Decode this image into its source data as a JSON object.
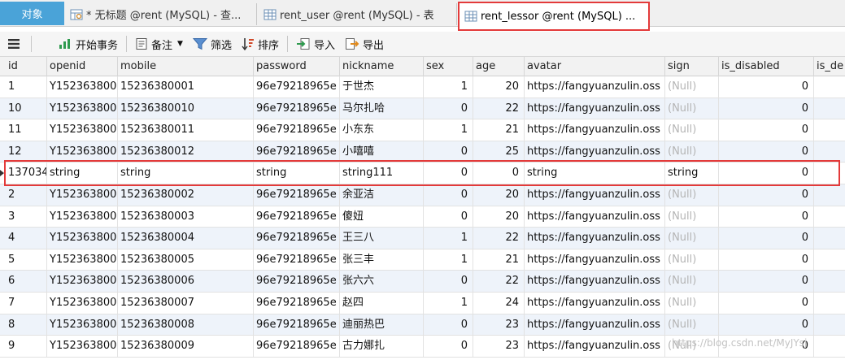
{
  "tabs": {
    "objects_label": "对象",
    "query_tab_label": "* 无标题 @rent (MySQL) - 查...",
    "user_tab_label": "rent_user @rent (MySQL) - 表",
    "active_tab_label": "rent_lessor @rent (MySQL) ..."
  },
  "toolbar": {
    "menu_icon": "hamburger-icon",
    "begin_tx_label": "开始事务",
    "note_label": "备注",
    "filter_label": "筛选",
    "sort_label": "排序",
    "import_label": "导入",
    "export_label": "导出"
  },
  "grid": {
    "columns": [
      "id",
      "openid",
      "mobile",
      "password",
      "nickname",
      "sex",
      "age",
      "avatar",
      "sign",
      "is_disabled",
      "is_de"
    ],
    "rows": [
      [
        "1",
        "Y152363800",
        "15236380001",
        "96e79218965e",
        "于世杰",
        "1",
        "20",
        "https://fangyuanzulin.oss",
        "(Null)",
        "0"
      ],
      [
        "10",
        "Y152363800",
        "15236380010",
        "96e79218965e",
        "马尔扎哈",
        "0",
        "22",
        "https://fangyuanzulin.oss",
        "(Null)",
        "0"
      ],
      [
        "11",
        "Y152363800",
        "15236380011",
        "96e79218965e",
        "小东东",
        "1",
        "21",
        "https://fangyuanzulin.oss",
        "(Null)",
        "0"
      ],
      [
        "12",
        "Y152363800",
        "15236380012",
        "96e79218965e",
        "小嘻嘻",
        "0",
        "25",
        "https://fangyuanzulin.oss",
        "(Null)",
        "0"
      ],
      [
        "137034",
        "string",
        "string",
        "string",
        "string111",
        "0",
        "0",
        "string",
        "string",
        "0"
      ],
      [
        "2",
        "Y152363800",
        "15236380002",
        "96e79218965e",
        "余亚洁",
        "0",
        "20",
        "https://fangyuanzulin.oss",
        "(Null)",
        "0"
      ],
      [
        "3",
        "Y152363800",
        "15236380003",
        "96e79218965e",
        "傻妞",
        "0",
        "20",
        "https://fangyuanzulin.oss",
        "(Null)",
        "0"
      ],
      [
        "4",
        "Y152363800",
        "15236380004",
        "96e79218965e",
        "王三八",
        "1",
        "22",
        "https://fangyuanzulin.oss",
        "(Null)",
        "0"
      ],
      [
        "5",
        "Y152363800",
        "15236380005",
        "96e79218965e",
        "张三丰",
        "1",
        "21",
        "https://fangyuanzulin.oss",
        "(Null)",
        "0"
      ],
      [
        "6",
        "Y152363800",
        "15236380006",
        "96e79218965e",
        "张六六",
        "0",
        "22",
        "https://fangyuanzulin.oss",
        "(Null)",
        "0"
      ],
      [
        "7",
        "Y152363800",
        "15236380007",
        "96e79218965e",
        "赵四",
        "1",
        "24",
        "https://fangyuanzulin.oss",
        "(Null)",
        "0"
      ],
      [
        "8",
        "Y152363800",
        "15236380008",
        "96e79218965e",
        "迪丽热巴",
        "0",
        "23",
        "https://fangyuanzulin.oss",
        "(Null)",
        "0"
      ],
      [
        "9",
        "Y152363800",
        "15236380009",
        "96e79218965e",
        "古力娜扎",
        "0",
        "23",
        "https://fangyuanzulin.oss",
        "(Null)",
        "0"
      ]
    ]
  },
  "watermark": "https://blog.csdn.net/MyJYsj",
  "colors": {
    "highlight": "#e33a3a",
    "objects_tab": "#4aa3d8",
    "alt_row": "#eef3fa",
    "null_text": "#b5b5b5"
  }
}
